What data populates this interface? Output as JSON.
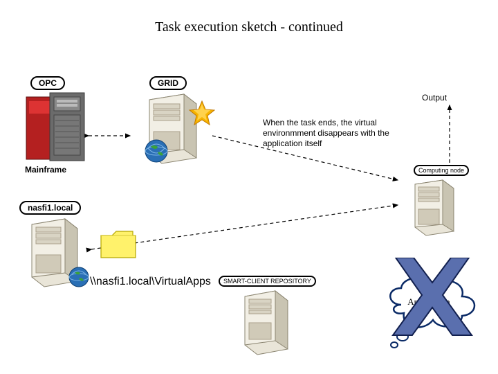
{
  "title": "Task execution sketch - continued",
  "labels": {
    "opc": "OPC",
    "grid": "GRID",
    "mainframe_caption": "Mainframe",
    "nasfi": "nasfi1.local",
    "computing_node": "Computing node",
    "smart_repo": "SMART-CLIENT REPOSITORY",
    "output": "Output",
    "application": "Application"
  },
  "explanation": "When the task ends, the virtual environmment disappears with the application itself",
  "path": "\\\\nasfi1.local\\VirtualApps",
  "colors": {
    "server_body": "#e9e5d8",
    "server_shadow": "#c9c4b2",
    "server_dark": "#9b9583",
    "globe_blue": "#2a6fb5",
    "globe_green": "#3aa23a",
    "mainframe_red": "#b42020",
    "mainframe_grey": "#6b6b6b",
    "folder": "#fff26b",
    "folder_border": "#b5a600",
    "x_fill": "#5a6fae",
    "x_border": "#12204f",
    "cloud_fill": "#ffffff",
    "cloud_border": "#0a2a66"
  }
}
